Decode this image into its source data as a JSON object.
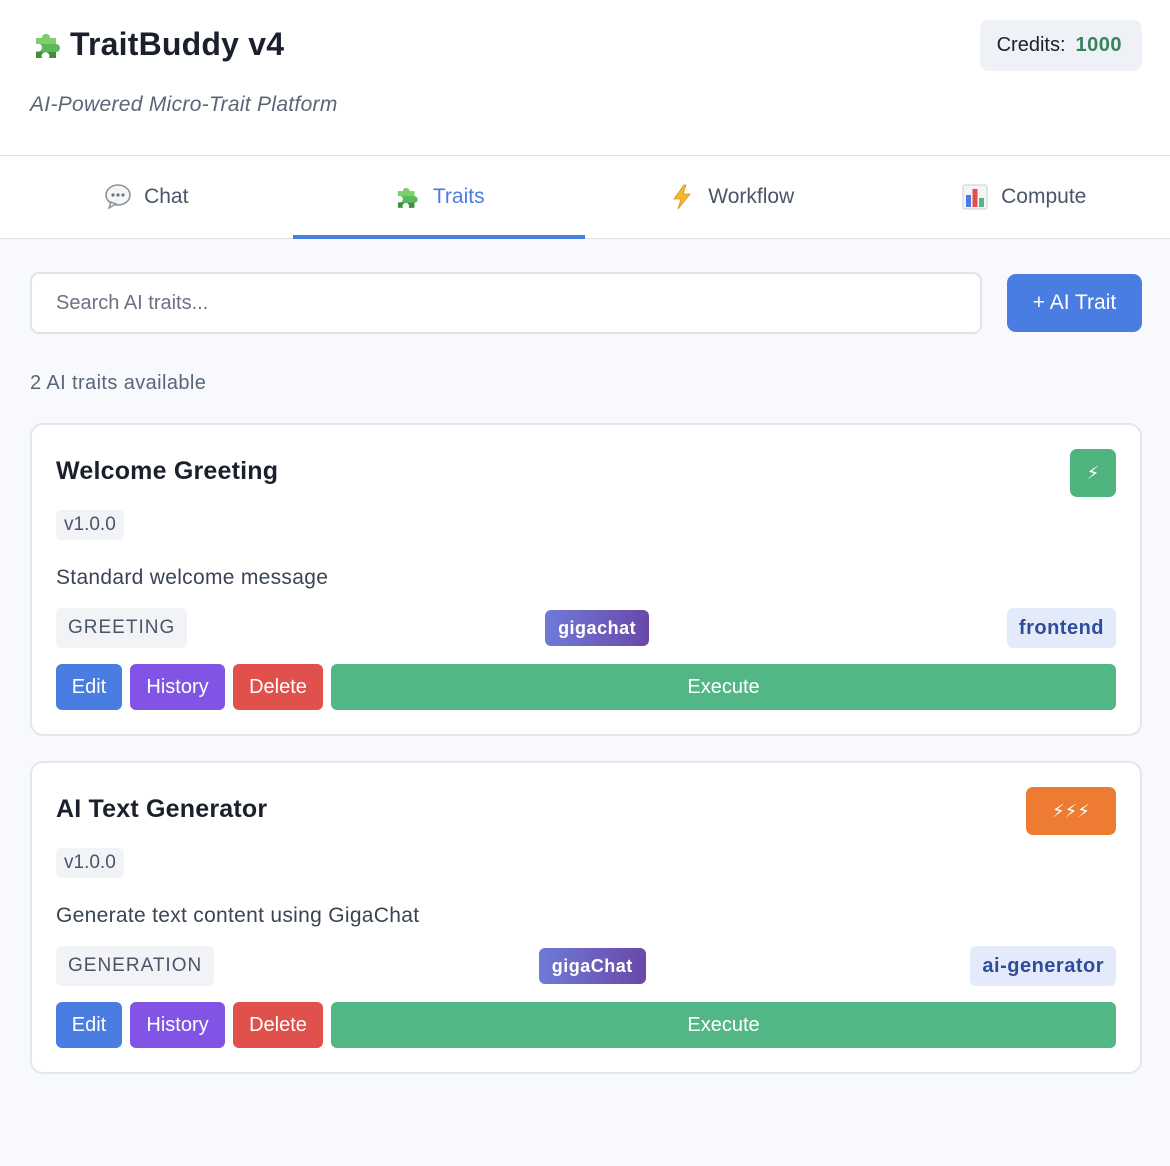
{
  "header": {
    "title": "TraitBuddy v4",
    "subtitle": "AI-Powered Micro-Trait Platform",
    "credits_label": "Credits:",
    "credits_value": "1000",
    "logo_icon": "puzzle-icon"
  },
  "tabs": [
    {
      "label": "Chat",
      "icon": "speech-bubble-icon",
      "active": false
    },
    {
      "label": "Traits",
      "icon": "puzzle-icon",
      "active": true
    },
    {
      "label": "Workflow",
      "icon": "lightning-icon",
      "active": false
    },
    {
      "label": "Compute",
      "icon": "bar-chart-icon",
      "active": false
    }
  ],
  "search": {
    "placeholder": "Search AI traits...",
    "value": "",
    "add_button_label": "+ AI Trait"
  },
  "traits_count_text": "2 AI traits available",
  "traits": [
    {
      "title": "Welcome Greeting",
      "version": "v1.0.0",
      "description": "Standard welcome message",
      "category": "GREETING",
      "provider": "gigachat",
      "domain": "frontend",
      "cost_badge": "⚡",
      "cost_color": "#4fb37e",
      "actions": {
        "edit": "Edit",
        "history": "History",
        "delete": "Delete",
        "execute": "Execute"
      }
    },
    {
      "title": "AI Text Generator",
      "version": "v1.0.0",
      "description": "Generate text content using GigaChat",
      "category": "GENERATION",
      "provider": "gigaChat",
      "domain": "ai-generator",
      "cost_badge": "⚡⚡⚡",
      "cost_color": "#ee7b32",
      "actions": {
        "edit": "Edit",
        "history": "History",
        "delete": "Delete",
        "execute": "Execute"
      }
    }
  ],
  "colors": {
    "accent": "#4a7de2",
    "success": "#52b784",
    "danger": "#e0514c",
    "purple": "#8254e6",
    "credits_green": "#38845a"
  }
}
